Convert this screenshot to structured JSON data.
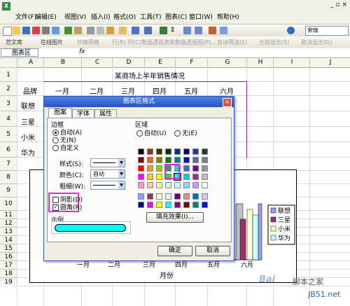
{
  "menu": [
    "文件(F)",
    "编辑(E)",
    "视图(V)",
    "插入(I)",
    "格式(O)",
    "工具(T)",
    "图表(C)",
    "窗口(W)",
    "帮助(H)"
  ],
  "toolbar": {
    "zoom_value": "",
    "font_name": "宋体",
    "row2_items": [
      "范文库",
      "在线图片",
      "切换网格",
      "行(R)",
      "列(C)",
      "数据透视表和数据透视图(P)...",
      "自动筛选(E)",
      "全部显示(S)",
      "取消显示(G)"
    ]
  },
  "formula_bar": {
    "name_box": "图表区",
    "fx": "fx"
  },
  "columns": [
    "A",
    "B",
    "C",
    "D",
    "E",
    "F",
    "G",
    "H",
    "I",
    "J"
  ],
  "rows": [
    "1",
    "2",
    "3",
    "4",
    "5",
    "6",
    "7",
    "8",
    "9",
    "10",
    "11",
    "12",
    "13",
    "14",
    "15",
    "16",
    "17",
    "18",
    "19"
  ],
  "sheet": {
    "title": "某商场上半年销售情况",
    "header": [
      "品牌",
      "一月",
      "二月",
      "三月",
      "四月",
      "五月",
      "六月"
    ],
    "brands": [
      "联想",
      "三星",
      "小米",
      "华为"
    ]
  },
  "chart_data": {
    "type": "bar",
    "categories": [
      "一月",
      "二月",
      "三月",
      "四月",
      "五月",
      "六月"
    ],
    "xlabel": "月份",
    "series": [
      {
        "name": "联想",
        "values": []
      },
      {
        "name": "三星",
        "values": []
      },
      {
        "name": "小米",
        "values": []
      },
      {
        "name": "华为",
        "values": []
      }
    ],
    "legend": "right"
  },
  "legend_colors": [
    "#9999ff",
    "#993366",
    "#ffffcc",
    "#ccffff"
  ],
  "dialog": {
    "title": "图表区格式",
    "tabs": [
      "图案",
      "字体",
      "属性"
    ],
    "border_section": "边框",
    "border_options": [
      "自动(A)",
      "无(N)",
      "自定义"
    ],
    "style_label": "样式(S):",
    "color_label": "颜色(C):",
    "color_value": "自动",
    "weight_label": "粗细(W):",
    "shadow_label": "阴影(D)",
    "round_label": "圆角(R)",
    "round_checked": true,
    "sample_label": "示例",
    "sample_color": "#00ffff",
    "area_section": "区域",
    "area_options": [
      "自动(U)",
      "无(E)"
    ],
    "fill_button": "填充效果(I)...",
    "ok_button": "确定",
    "cancel_button": "取消",
    "palette": [
      "#000000",
      "#993300",
      "#333300",
      "#003300",
      "#003366",
      "#000080",
      "#333399",
      "#333333",
      "#800000",
      "#ff6600",
      "#808000",
      "#008000",
      "#008080",
      "#0000ff",
      "#666699",
      "#808080",
      "#ff0000",
      "#ff9900",
      "#99cc00",
      "#339966",
      "#33cccc",
      "#3366ff",
      "#800080",
      "#969696",
      "#ff00ff",
      "#ffcc00",
      "#ffff00",
      "#00ff00",
      "#00ffff",
      "#00ccff",
      "#993366",
      "#c0c0c0",
      "#ff99cc",
      "#ffcc99",
      "#ffff99",
      "#ccffcc",
      "#ccffff",
      "#99ccff",
      "#cc99ff",
      "#ffffff"
    ],
    "palette2": [
      "#9999ff",
      "#993366",
      "#ffffcc",
      "#ccffff",
      "#660066",
      "#ff8080",
      "#0066cc",
      "#ccccff",
      "#000080",
      "#ff00ff",
      "#ffff00",
      "#00ffff",
      "#800080",
      "#800000",
      "#008080",
      "#0000ff"
    ]
  },
  "watermark": {
    "logo": "Bai",
    "site1": "脚本之家",
    "site2": "JB51.net"
  }
}
